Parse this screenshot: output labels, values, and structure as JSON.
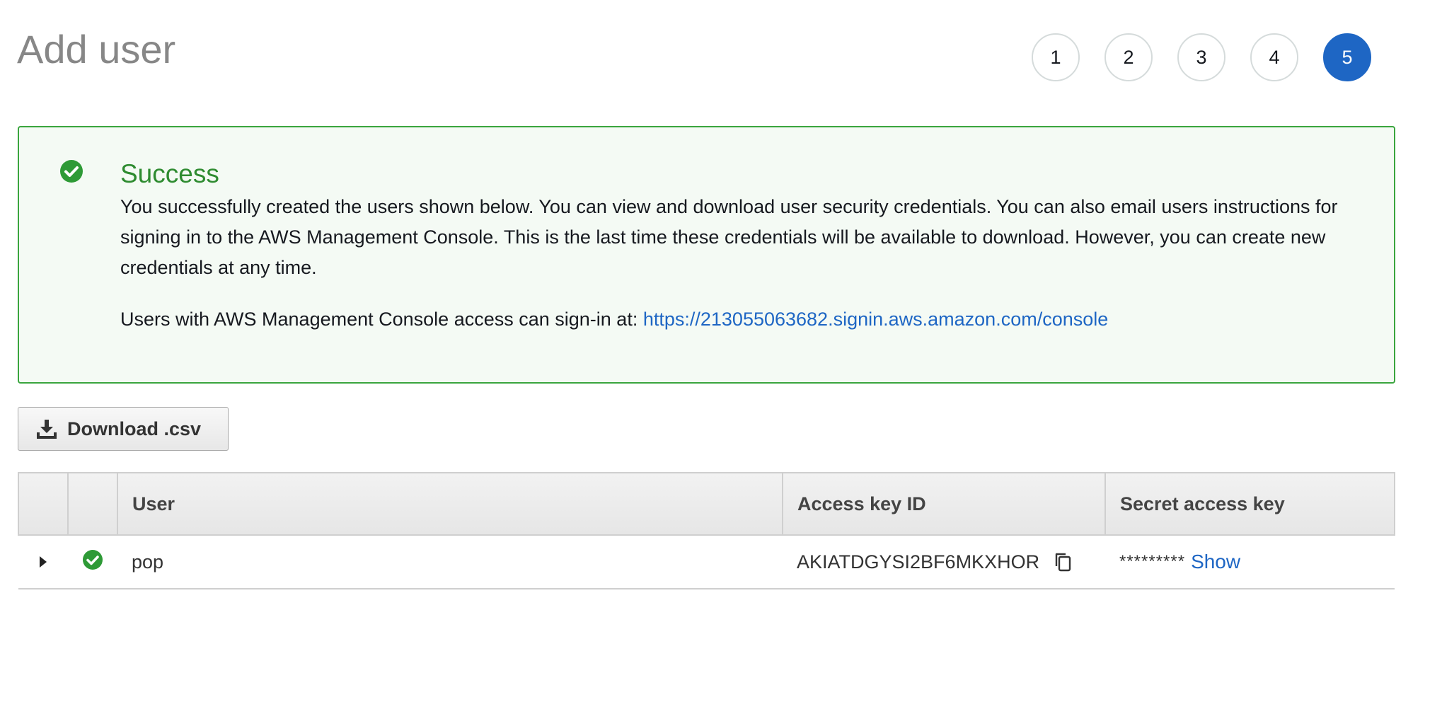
{
  "page": {
    "title": "Add user"
  },
  "steps": [
    {
      "label": "1",
      "active": false
    },
    {
      "label": "2",
      "active": false
    },
    {
      "label": "3",
      "active": false
    },
    {
      "label": "4",
      "active": false
    },
    {
      "label": "5",
      "active": true
    }
  ],
  "alert": {
    "title": "Success",
    "message": "You successfully created the users shown below. You can view and download user security credentials. You can also email users instructions for signing in to the AWS Management Console. This is the last time these credentials will be available to download. However, you can create new credentials at any time.",
    "signin_text": "Users with AWS Management Console access can sign-in at:",
    "signin_url": "https://213055063682.signin.aws.amazon.com/console",
    "icon": "check-circle-icon",
    "color": "#2e8b30"
  },
  "toolbar": {
    "download_label": "Download .csv",
    "download_icon": "download-icon"
  },
  "table": {
    "columns": [
      "",
      "",
      "User",
      "Access key ID",
      "Secret access key"
    ],
    "rows": [
      {
        "user": "pop",
        "access_key_id": "AKIATDGYSI2BF6MKXHOR",
        "secret_masked": "*********",
        "show_label": "Show"
      }
    ]
  },
  "colors": {
    "accent": "#1e66c4",
    "success": "#3aa53e"
  }
}
